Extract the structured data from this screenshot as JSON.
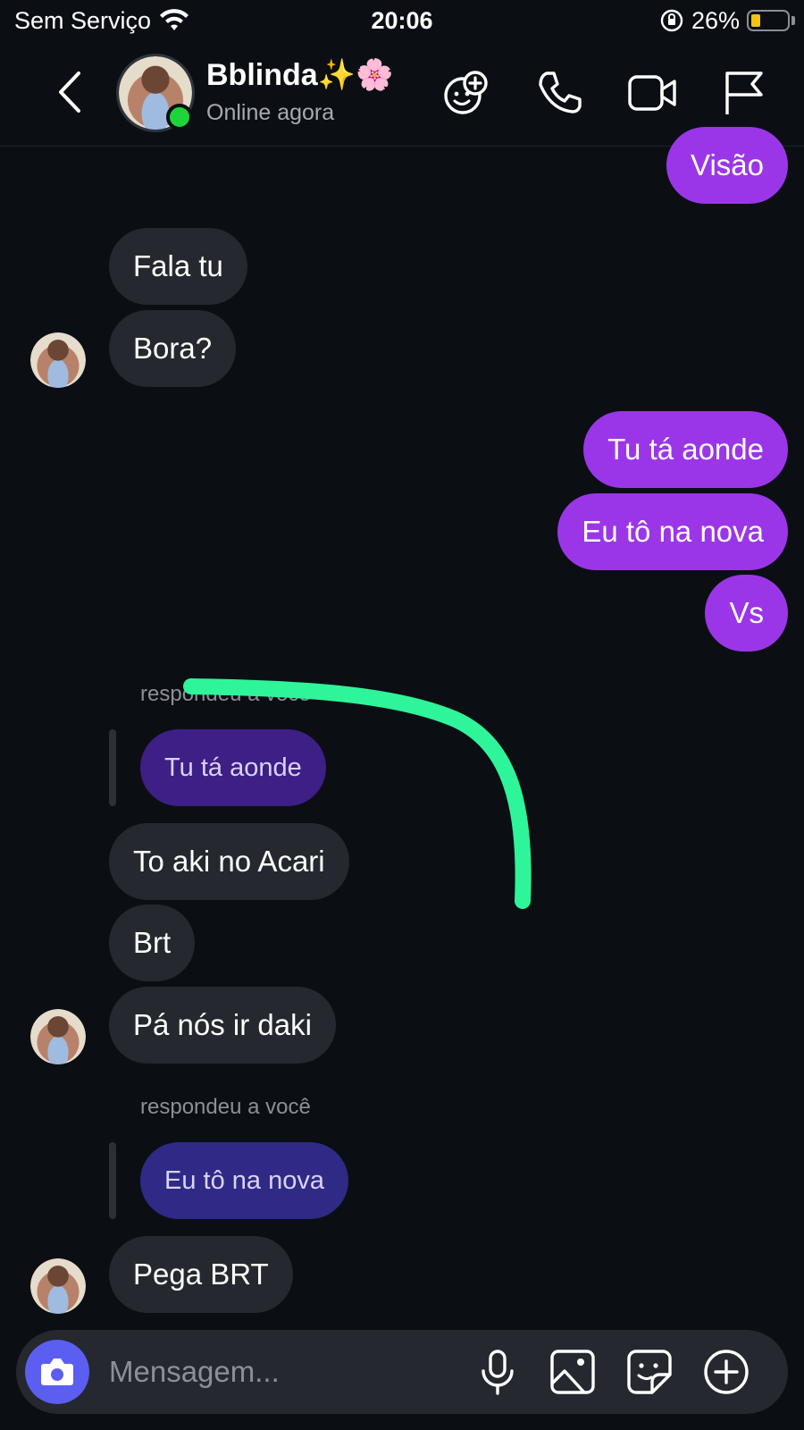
{
  "status_bar": {
    "carrier": "Sem Serviço",
    "time": "20:06",
    "battery": "26%",
    "battery_level": 0.26,
    "battery_color": "#f2c40e"
  },
  "header": {
    "name": "Bblinda✨🌸",
    "status": "Online agora",
    "online_color": "#1ed43a",
    "icons": [
      "chevron-left-icon",
      "add-effect-icon",
      "phone-icon",
      "video-icon",
      "flag-icon"
    ]
  },
  "messages": [
    {
      "from": "me",
      "text": "Visão"
    },
    {
      "from": "them",
      "text": "Fala tu"
    },
    {
      "from": "them",
      "text": "Bora?"
    },
    {
      "from": "me",
      "text": "Tu tá aonde"
    },
    {
      "from": "me",
      "text": "Eu tô na nova"
    },
    {
      "from": "me",
      "text": "Vs"
    },
    {
      "from": "them",
      "reply_label": "respondeu a você",
      "quoted": "Tu tá aonde"
    },
    {
      "from": "them",
      "text": "To aki no Acari"
    },
    {
      "from": "them",
      "text": "Brt"
    },
    {
      "from": "them",
      "text": "Pá nós ir daki"
    },
    {
      "from": "them",
      "reply_label": "respondeu a você",
      "quoted": "Eu tô na nova"
    },
    {
      "from": "them",
      "text": "Pega BRT"
    }
  ],
  "composer": {
    "placeholder": "Mensagem...",
    "icons": [
      "camera-icon",
      "microphone-icon",
      "image-icon",
      "sticker-icon",
      "plus-circle-icon"
    ]
  },
  "colors": {
    "background": "#0b0f14",
    "incoming_bubble": "#25282e",
    "outgoing_bubble": "#9b36e8",
    "quoted_bubble": "#3d1f86",
    "camera_button": "#5b5ef0",
    "annotation_stroke": "#2ef59a"
  }
}
